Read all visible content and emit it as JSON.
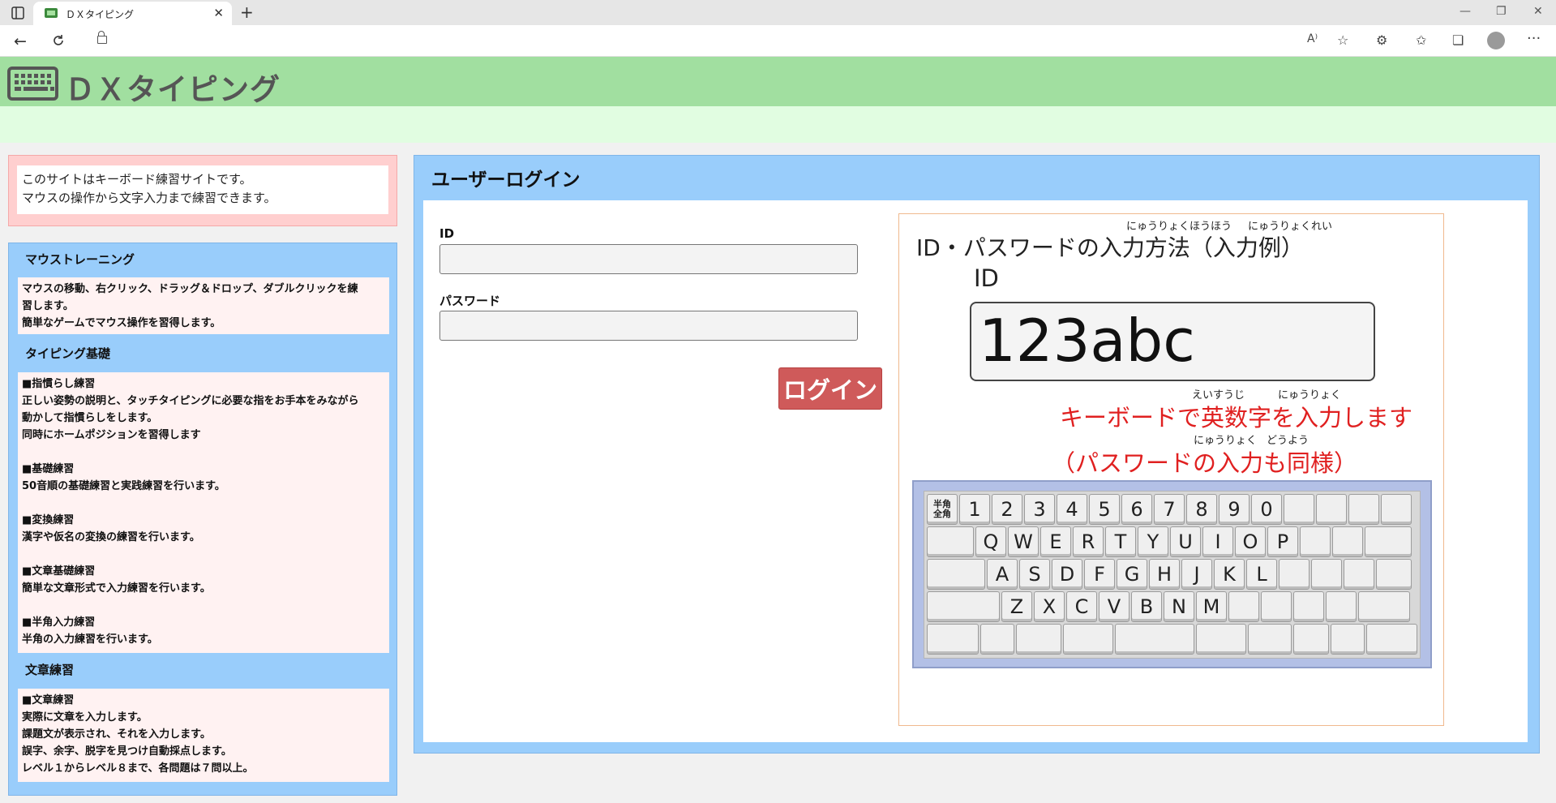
{
  "browser": {
    "tab_title": "ＤＸタイピング",
    "tab_close": "✕",
    "new_tab": "+",
    "window_min": "—",
    "window_max": "❐",
    "window_close": "✕",
    "icons": [
      "sidebar-icon",
      "back-icon",
      "refresh-icon",
      "lock-icon",
      "read-aloud-icon",
      "add-favorite-icon",
      "extensions-icon",
      "favorites-icon",
      "collections-icon",
      "profile-icon",
      "more-icon"
    ]
  },
  "site": {
    "title": "ＤＸタイピング",
    "header_color": "#a1dfa0",
    "subheader_color": "#e1fde1"
  },
  "intro": {
    "line1": "このサイトはキーボード練習サイトです。",
    "line2": "マウスの操作から文字入力まで練習できます。"
  },
  "menu": {
    "mouse": {
      "heading": "マウストレーニング",
      "lines": [
        "マウスの移動、右クリック、ドラッグ＆ドロップ、ダブルクリックを練",
        "習します。",
        "簡単なゲームでマウス操作を習得します。"
      ]
    },
    "typing": {
      "heading": "タイピング基礎",
      "lines": [
        "■指慣らし練習",
        "正しい姿勢の説明と、タッチタイピングに必要な指をお手本をみながら",
        "動かして指慣らしをします。",
        "同時にホームポジションを習得します",
        "",
        "■基礎練習",
        "50音順の基礎練習と実践練習を行います。",
        "",
        "■変換練習",
        "漢字や仮名の変換の練習を行います。",
        "",
        "■文章基礎練習",
        "簡単な文章形式で入力練習を行います。",
        "",
        "■半角入力練習",
        "半角の入力練習を行います。"
      ]
    },
    "sentence": {
      "heading": "文章練習",
      "lines": [
        "■文章練習",
        "実際に文章を入力します。",
        "課題文が表示され、それを入力します。",
        "誤字、余字、脱字を見つけ自動採点します。",
        "レベル１からレベル８まで、各問題は７問以上。"
      ]
    }
  },
  "login": {
    "title": "ユーザーログイン",
    "id_label": "ID",
    "id_value": "",
    "password_label": "パスワード",
    "password_value": "",
    "button_label": "ログイン",
    "button_color": "#cf5a5a"
  },
  "example": {
    "ruby_input_method": "にゅうりょくほうほう",
    "ruby_input_example": "にゅうりょくれい",
    "title": "ID・パスワードの入力方法（入力例）",
    "id_label": "ID",
    "sample_value": "123abc",
    "ruby_eisuuji": "えいすうじ",
    "ruby_nyuuryoku1": "にゅうりょく",
    "instruction": "キーボードで英数字を入力します",
    "ruby_nyuuryoku2": "にゅうりょく",
    "ruby_douyou": "どうよう",
    "note": "（パスワードの入力も同様）",
    "instruction_color": "#e02020"
  },
  "keyboard": {
    "hankaku_label": "半角\n全角",
    "row1": [
      "1",
      "2",
      "3",
      "4",
      "5",
      "6",
      "7",
      "8",
      "9",
      "0",
      "",
      "",
      "",
      ""
    ],
    "row2": [
      "Q",
      "W",
      "E",
      "R",
      "T",
      "Y",
      "U",
      "I",
      "O",
      "P",
      "",
      ""
    ],
    "row3": [
      "A",
      "S",
      "D",
      "F",
      "G",
      "H",
      "J",
      "K",
      "L",
      "",
      "",
      ""
    ],
    "row4": [
      "Z",
      "X",
      "C",
      "V",
      "B",
      "N",
      "M",
      "",
      "",
      "",
      "",
      ""
    ],
    "row5": [
      "",
      "",
      "",
      "",
      "",
      "",
      "",
      "",
      ""
    ]
  }
}
